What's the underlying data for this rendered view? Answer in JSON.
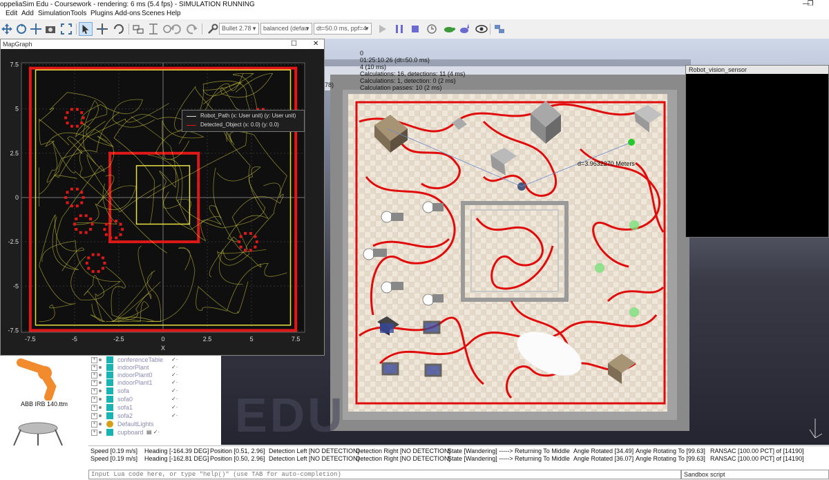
{
  "window": {
    "title": "oppeliaSim Edu - Coursework - rendering: 6 ms (5.4 fps) - SIMULATION RUNNING"
  },
  "menu": [
    "Edit",
    "Add",
    "Simulation",
    "Tools",
    "Plugins",
    "Add-ons",
    "Scenes",
    "Help"
  ],
  "toolbar": {
    "engine": "Bullet 2.78",
    "accuracy": "balanced (defau",
    "timestep": "dt=50.0 ms, ppf=4"
  },
  "mapgraph": {
    "title": "MapGraph",
    "legend": [
      "Robot_Path (x: User unit) (y: User unit)",
      "Detected_Object (x: 0.0) (y: 0.0)"
    ],
    "xlabel": "X",
    "xticks": [
      "-7.5",
      "-5",
      "-2.5",
      "0",
      "2.5",
      "5",
      "7.5"
    ],
    "yticks": [
      "7.5",
      "5",
      "2.5",
      "0",
      "-2.5",
      "-5",
      "-7.5"
    ],
    "colors": {
      "path": "#e8e040",
      "object": "#e01818",
      "background": "#1e1e1e"
    }
  },
  "chart_data": {
    "type": "scatter",
    "xlabel": "X",
    "xlim": [
      -8,
      8
    ],
    "ylim": [
      -7.6,
      7.6
    ],
    "series": [
      {
        "name": "Robot_Path (x: User unit) (y: User unit)",
        "color": "#e8e040",
        "boundary": [
          [
            -7.2,
            7.2
          ],
          [
            7.2,
            7.2
          ],
          [
            7.2,
            -7.2
          ],
          [
            -7.2,
            -7.2
          ]
        ],
        "inner_square": [
          [
            -1.5,
            1.8
          ],
          [
            1.5,
            1.8
          ],
          [
            1.5,
            -1.5
          ],
          [
            -1.5,
            -1.5
          ]
        ]
      },
      {
        "name": "Detected_Object (x: 0.0) (y: 0.0)",
        "color": "#e01818",
        "outer_wall": [
          [
            -7.5,
            7.3
          ],
          [
            7.5,
            7.3
          ],
          [
            7.5,
            -7.5
          ],
          [
            -7.5,
            -7.5
          ]
        ],
        "inner_wall": [
          [
            -3,
            2.5
          ],
          [
            2,
            2.5
          ],
          [
            2,
            -2.5
          ],
          [
            -3,
            -2.5
          ]
        ]
      }
    ]
  },
  "viewport": {
    "info": [
      "0",
      "01:25:10.26 (dt=50.0 ms)",
      "4 (10 ms)",
      "Calculations: 16, detections: 11 (4 ms)",
      "Calculations: 1, detection: 0 (2 ms)",
      "Calculation passes: 10 (2 ms)"
    ],
    "distance_label": "d=3.9632270 Meters",
    "fragment": "78)",
    "watermark": "EDU"
  },
  "vision_sensor": {
    "title": "Robot_vision_sensor"
  },
  "model_browser": {
    "items": [
      "ABB IRB 140.ttm"
    ]
  },
  "scene_tree": {
    "items": [
      "conferenceTable",
      "indoorPlant",
      "indoorPlant0",
      "indoorPlant1",
      "sofa",
      "sofa0",
      "sofa1",
      "sofa2",
      "DefaultLights",
      "cupboard"
    ]
  },
  "status_lines": [
    {
      "speed": "Speed [0.19 m/s]",
      "heading": "Heading [-164.39 DEG]",
      "position": "Position [0.51, 2.96]",
      "det_left": "Detection Left [NO DETECTION]",
      "det_right": "Detection Right [NO DETECTION]",
      "state": "State [Wandering] -----> Returning To Middle",
      "angle_rot": "Angle Rotated [34.49]",
      "angle_to": "Angle Rotating To [99.63]",
      "ransac": "RANSAC [100.00 PCT] of [14190]"
    },
    {
      "speed": "Speed [0.19 m/s]",
      "heading": "Heading [-162.81 DEG]",
      "position": "Position [0.50, 2.96]",
      "det_left": "Detection Left [NO DETECTION]",
      "det_right": "Detection Right [NO DETECTION]",
      "state": "State [Wandering] -----> Returning To Middle",
      "angle_rot": "Angle Rotated [36.07]",
      "angle_to": "Angle Rotating To [99.63]",
      "ransac": "RANSAC [100.00 PCT] of [14190]"
    }
  ],
  "command": {
    "placeholder": "Input Lua code here, or type \"help()\" (use TAB for auto-completion)",
    "mode": "Sandbox script"
  }
}
